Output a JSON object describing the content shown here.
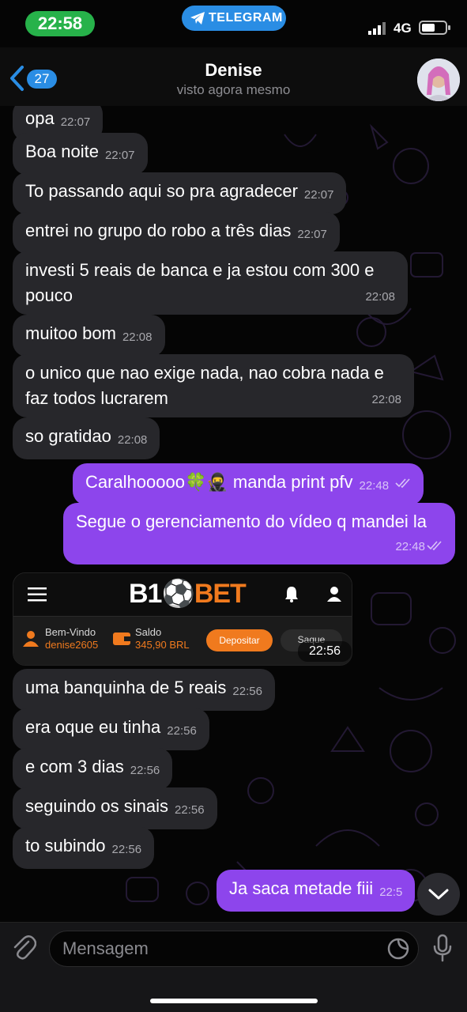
{
  "status_bar": {
    "time": "22:58",
    "app_pill": "TELEGRAM",
    "network": "4G"
  },
  "header": {
    "unread_count": "27",
    "contact_name": "Denise",
    "contact_status": "visto agora mesmo"
  },
  "messages": [
    {
      "text": "opa",
      "time": "22:07",
      "direction": "in"
    },
    {
      "text": "Boa noite",
      "time": "22:07",
      "direction": "in"
    },
    {
      "text": "To passando aqui so pra agradecer",
      "time": "22:07",
      "direction": "in"
    },
    {
      "text": "entrei no grupo do robo a três dias",
      "time": "22:07",
      "direction": "in"
    },
    {
      "text": "investi 5 reais de banca e ja estou com 300 e pouco",
      "time": "22:08",
      "direction": "in"
    },
    {
      "text": "muitoo bom",
      "time": "22:08",
      "direction": "in"
    },
    {
      "text": "o unico que nao exige nada, nao cobra nada e faz todos lucrarem",
      "time": "22:08",
      "direction": "in"
    },
    {
      "text": "so gratidao",
      "time": "22:08",
      "direction": "in"
    },
    {
      "text": "Caralhooooo🍀🥷 manda print pfv",
      "time": "22:48",
      "direction": "out"
    },
    {
      "text": "Segue o gerenciamento do vídeo q mandei la",
      "time": "22:48",
      "direction": "out"
    },
    {
      "text": "uma banquinha de 5 reais",
      "time": "22:56",
      "direction": "in"
    },
    {
      "text": "era oque eu tinha",
      "time": "22:56",
      "direction": "in"
    },
    {
      "text": "e com 3 dias",
      "time": "22:56",
      "direction": "in"
    },
    {
      "text": "seguindo os sinais",
      "time": "22:56",
      "direction": "in"
    },
    {
      "text": "to subindo",
      "time": "22:56",
      "direction": "in"
    },
    {
      "text": "Ja saca metade fiii",
      "time": "22:5",
      "direction": "out"
    }
  ],
  "image_message": {
    "logo_left": "B1",
    "logo_right": "BET",
    "welcome_label": "Bem-Vindo",
    "username": "denise2605",
    "balance_label": "Saldo",
    "balance_value": "345,90 BRL",
    "deposit_button": "Depositar",
    "withdraw_button": "Saque",
    "time": "22:56"
  },
  "input": {
    "placeholder": "Mensagem"
  },
  "colors": {
    "incoming_bubble": "#27272b",
    "outgoing_bubble": "#8d45ec",
    "status_time_pill": "#27b24a",
    "telegram_blue": "#2a8de4",
    "b1bet_orange": "#f07a1e"
  },
  "icons": [
    "back-chevron-icon",
    "telegram-plane-icon",
    "signal-icon",
    "battery-icon",
    "menu-icon",
    "bell-icon",
    "user-icon",
    "read-ticks-icon",
    "chevron-down-icon",
    "paperclip-icon",
    "sticker-icon",
    "microphone-icon"
  ]
}
